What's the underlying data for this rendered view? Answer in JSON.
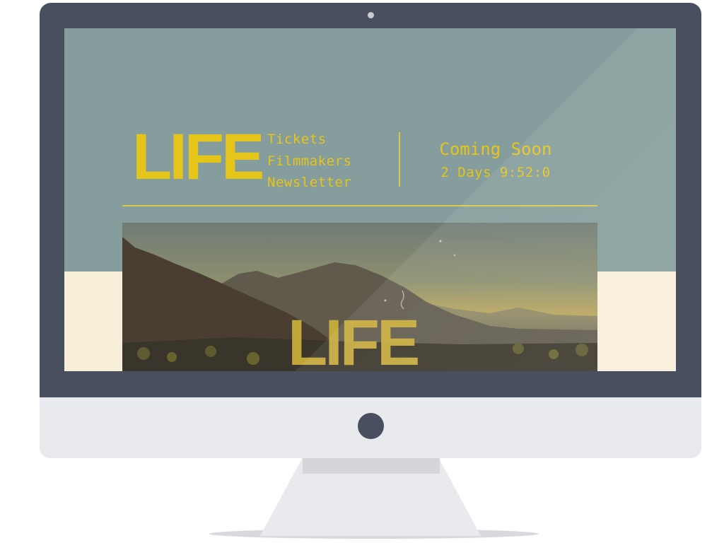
{
  "site": {
    "logo": "LIFE",
    "nav": [
      {
        "label": "Tickets"
      },
      {
        "label": "Filmmakers"
      },
      {
        "label": "Newsletter"
      }
    ],
    "status": "Coming Soon",
    "countdown": "2 Days 9:52:0"
  },
  "hero": {
    "title": "LIFE"
  },
  "colors": {
    "accent": "#e6c51a",
    "screen_bg": "#859d9c",
    "cream": "#f7efd8",
    "bezel": "#4a4f60",
    "chin": "#e8eaee"
  }
}
